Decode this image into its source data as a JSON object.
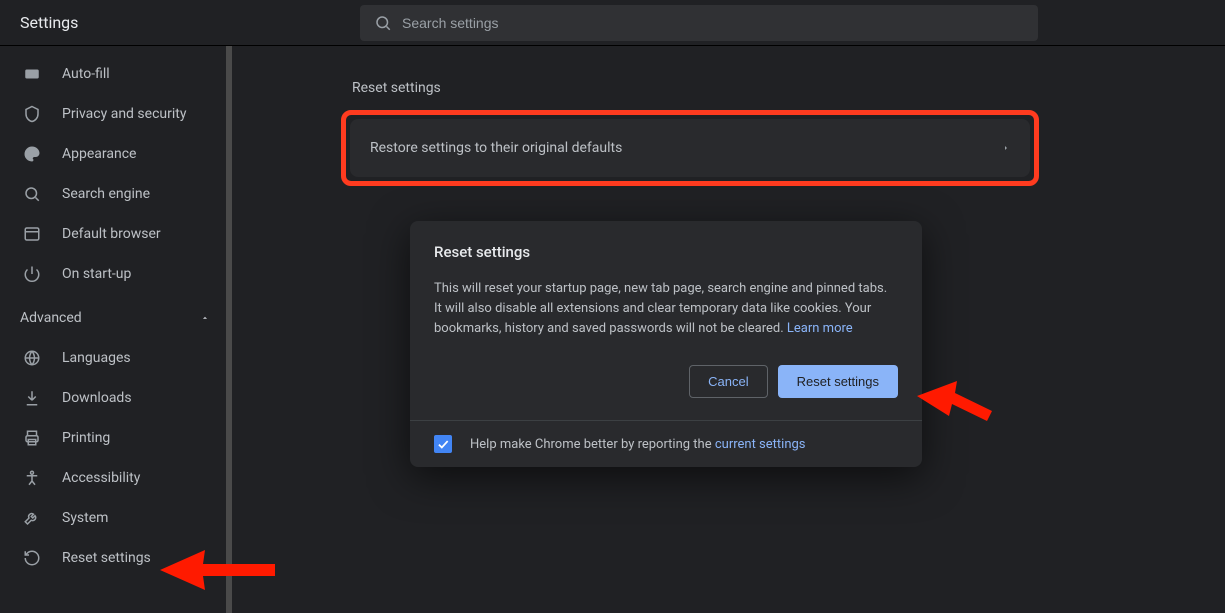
{
  "header": {
    "title": "Settings",
    "search_placeholder": "Search settings"
  },
  "sidebar": {
    "items_top": [
      {
        "label": "Auto-fill",
        "icon": "autofill"
      },
      {
        "label": "Privacy and security",
        "icon": "shield"
      },
      {
        "label": "Appearance",
        "icon": "palette"
      },
      {
        "label": "Search engine",
        "icon": "search"
      },
      {
        "label": "Default browser",
        "icon": "browser"
      },
      {
        "label": "On start-up",
        "icon": "power"
      }
    ],
    "advanced_label": "Advanced",
    "items_bottom": [
      {
        "label": "Languages",
        "icon": "globe"
      },
      {
        "label": "Downloads",
        "icon": "download"
      },
      {
        "label": "Printing",
        "icon": "print"
      },
      {
        "label": "Accessibility",
        "icon": "accessibility"
      },
      {
        "label": "System",
        "icon": "wrench"
      },
      {
        "label": "Reset settings",
        "icon": "history"
      }
    ]
  },
  "main": {
    "section_title": "Reset settings",
    "card_label": "Restore settings to their original defaults"
  },
  "dialog": {
    "title": "Reset settings",
    "body_text": "This will reset your startup page, new tab page, search engine and pinned tabs. It will also disable all extensions and clear temporary data like cookies. Your bookmarks, history and saved passwords will not be cleared. ",
    "learn_more": "Learn more",
    "cancel": "Cancel",
    "confirm": "Reset settings",
    "footer_text": "Help make Chrome better by reporting the ",
    "footer_link": "current settings"
  }
}
